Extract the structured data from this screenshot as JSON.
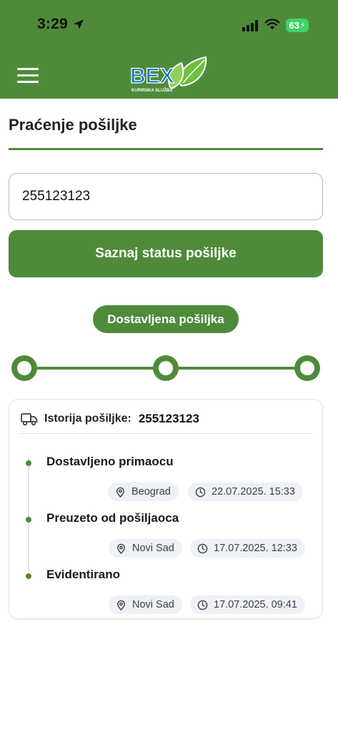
{
  "status_bar": {
    "time": "3:29",
    "battery": "63"
  },
  "header": {
    "logo_text": "BEX",
    "logo_subtext": "KURIRSKA SLUŽBA"
  },
  "page": {
    "title": "Praćenje pošiljke"
  },
  "form": {
    "tracking_value": "255123123",
    "submit_label": "Saznaj status pošiljke"
  },
  "status": {
    "label": "Dostavljena pošiljka"
  },
  "history": {
    "label": "Istorija pošiljke:",
    "number": "255123123",
    "events": [
      {
        "title": "Dostavljeno primaocu",
        "location": "Beograd",
        "datetime": "22.07.2025. 15:33"
      },
      {
        "title": "Preuzeto od pošiljaoca",
        "location": "Novi Sad",
        "datetime": "17.07.2025. 12:33"
      },
      {
        "title": "Evidentirano",
        "location": "Novi Sad",
        "datetime": "17.07.2025. 09:41"
      }
    ]
  },
  "colors": {
    "brand_green": "#4d8b3a",
    "chip_bg": "#eef1f5",
    "logo_blue": "#1d77c4"
  },
  "icons": {
    "menu": "hamburger-icon",
    "truck": "truck-icon",
    "location": "map-pin-icon",
    "time": "clock-icon"
  }
}
